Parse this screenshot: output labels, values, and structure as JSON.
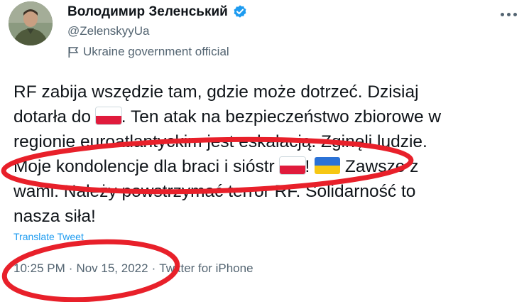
{
  "author": {
    "name": "Володимир Зеленський",
    "handle": "@ZelenskyyUa",
    "label": "Ukraine government official",
    "verified_color": "#1d9bf0"
  },
  "tweet": {
    "line1": "RF zabija wszędzie tam, gdzie może dotrzeć. Dzisiaj",
    "line2_a": "dotarła do ",
    "line2_b": ". Ten atak na bezpieczeństwo zbiorowe w",
    "line3": "regionie euroatlantyckim jest eskalacją.  Zginęli ludzie.",
    "line4_a": "Moje kondolencje dla braci i sióstr ",
    "line4_b": "! ",
    "line4_c": " Zawsze z",
    "line5": "wami. Należy powstrzymać terror RF.  Solidarność to",
    "line6": "nasza siła!"
  },
  "translate_label": "Translate Tweet",
  "meta": {
    "time": "10:25 PM",
    "sep1": "·",
    "date": "Nov 15, 2022",
    "sep2": "·",
    "source": "Twitter for iPhone"
  },
  "colors": {
    "annotation_red": "#e8202a",
    "link_blue": "#1d9bf0",
    "secondary_text": "#536471",
    "flag_pl_red": "#e01b3c",
    "flag_ua_blue": "#2b72d6",
    "flag_ua_yellow": "#f6c714"
  },
  "icons": [
    "verified-badge-icon",
    "government-flag-icon",
    "more-options-icon",
    "poland-flag-emoji",
    "ukraine-flag-emoji"
  ]
}
